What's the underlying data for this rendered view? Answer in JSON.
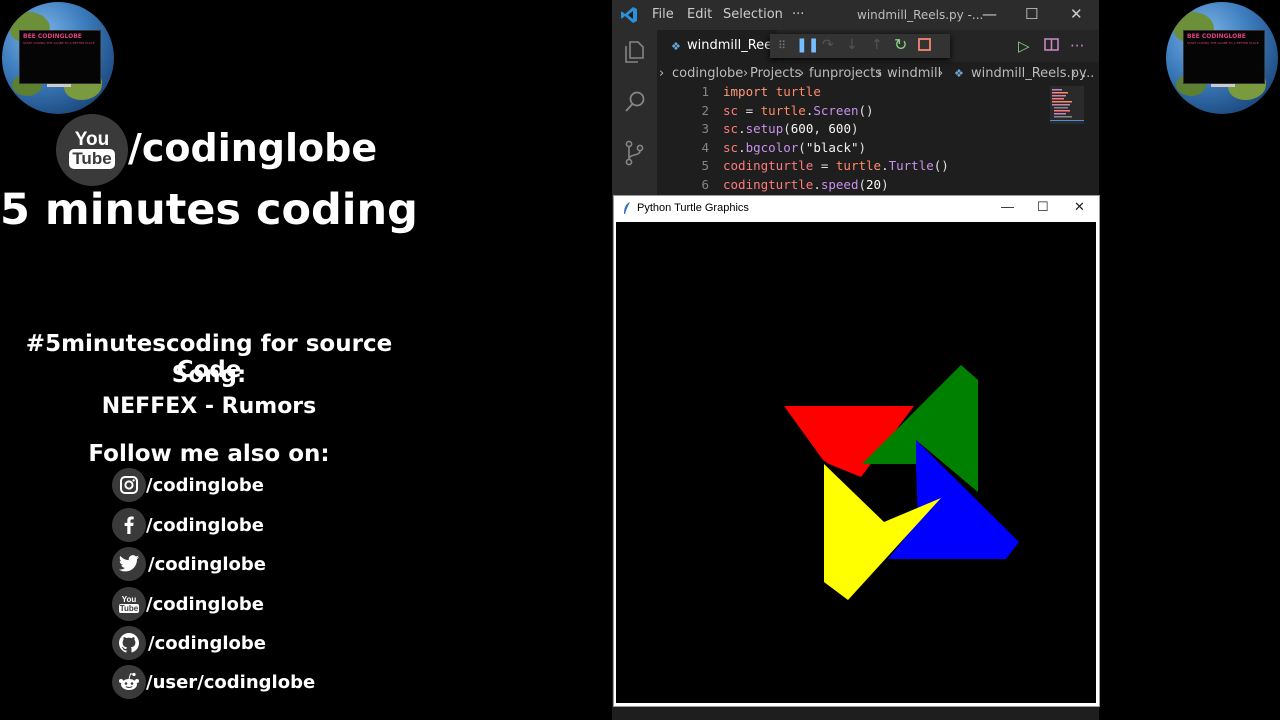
{
  "globe": {
    "title": "BEE CODINGLOBE",
    "tagline": "START CODING THE GLOBE TO A BETTER PLACE"
  },
  "channel": {
    "youtube_you": "You",
    "youtube_tube": "Tube",
    "handle": "/codinglobe",
    "tagline": "5 minutes coding"
  },
  "info": {
    "hashtag": "#5minutescoding for source Code",
    "song_label": "Song:",
    "song_name": "NEFFEX - Rumors",
    "follow": "Follow me also on:"
  },
  "social": [
    {
      "icon": "instagram-icon",
      "label": "/codinglobe"
    },
    {
      "icon": "facebook-icon",
      "label": "/codinglobe"
    },
    {
      "icon": "twitter-icon",
      "label": "/codinglobe"
    },
    {
      "icon": "youtube-icon",
      "label": "/codinglobe"
    },
    {
      "icon": "github-icon",
      "label": "/codinglobe"
    },
    {
      "icon": "reddit-icon",
      "label": "/user/codinglobe"
    }
  ],
  "vscode": {
    "menu": [
      "File",
      "Edit",
      "Selection",
      "···"
    ],
    "window_title": "windmill_Reels.py -...",
    "tab_name": "windmill_Reels",
    "breadcrumb": [
      "codinglobe",
      "Projects",
      "funprojects",
      "windmill",
      "windmill_Reels.py",
      "..."
    ],
    "line_numbers": [
      "1",
      "2",
      "3",
      "4",
      "5",
      "6"
    ]
  },
  "turtle_window": {
    "title": "Python Turtle Graphics",
    "shape_colors": [
      "#ff0000",
      "#008000",
      "#0000ff",
      "#ffff00"
    ]
  },
  "colors": {
    "background": "#000000",
    "vscode_bg": "#1e1e1e",
    "icon_circle": "#3a3a3a"
  }
}
